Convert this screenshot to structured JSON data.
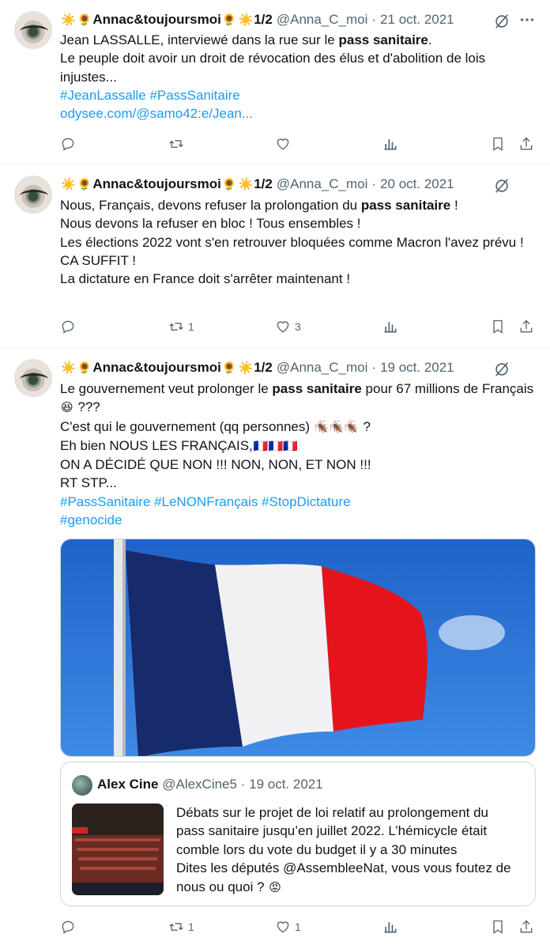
{
  "colors": {
    "text": "#0f1419",
    "muted": "#536471",
    "link": "#1d9bf0",
    "border": "#eff3f4"
  },
  "tweets": [
    {
      "name": "Annac&toujoursmoi",
      "name_suffix": "1/2",
      "handle": "@Anna_C_moi",
      "sep": "·",
      "date": "21 oct. 2021",
      "lines": {
        "l1_pre": "Jean LASSALLE, interviewé dans la rue sur le ",
        "l1_bold": "pass sanitaire",
        "l1_post": ".",
        "l2": "Le peuple doit avoir un droit de révocation des élus et d'abolition de lois injustes...",
        "tags": "#JeanLassalle #PassSanitaire",
        "url": "odysee.com/@samo42:e/Jean..."
      },
      "replies": "",
      "retweets": "",
      "likes": ""
    },
    {
      "name": "Annac&toujoursmoi",
      "name_suffix": "1/2",
      "handle": "@Anna_C_moi",
      "sep": "·",
      "date": "20 oct. 2021",
      "lines": {
        "l1_pre": "Nous, Français, devons refuser la prolongation du ",
        "l1_bold": "pass sanitaire",
        "l1_post": " !",
        "l2": "Nous devons la refuser en bloc ! Tous ensembles !",
        "l3": "Les élections 2022 vont s'en retrouver bloquées comme Macron l'avez prévu !",
        "l4": "CA SUFFIT !",
        "l5": "La dictature en France doit s'arrêter maintenant !"
      },
      "replies": "",
      "retweets": "1",
      "likes": "3"
    },
    {
      "name": "Annac&toujoursmoi",
      "name_suffix": "1/2",
      "handle": "@Anna_C_moi",
      "sep": "·",
      "date": "19 oct. 2021",
      "lines": {
        "l1_pre": "Le gouvernement veut prolonger le ",
        "l1_bold": "pass sanitaire",
        "l1_post": " pour 67 millions de Français",
        "l1_end": " ???",
        "l2": "C'est qui le gouvernement (qq personnes)",
        "l2_end": " ?",
        "l3": "Eh bien NOUS LES FRANÇAIS,",
        "l4": "ON A DÉCIDÉ QUE NON !!! NON, NON, ET NON !!!",
        "l5": "RT STP...",
        "tags1": "#PassSanitaire #LeNONFrançais #StopDictature",
        "tags2": "#genocide"
      },
      "quote": {
        "name": "Alex Cine",
        "handle": "@AlexCine5",
        "sep": "·",
        "date": "19 oct. 2021",
        "text_a": "Débats sur le projet de loi relatif au prolongement du pass sanitaire jusqu’en juillet 2022. L’hémicycle était comble lors du vote du budget il y a 30 minutes",
        "text_b": "Dites les députés @AssembleeNat, vous vous foutez de nous ou quoi ?"
      },
      "replies": "",
      "retweets": "1",
      "likes": "1"
    }
  ]
}
